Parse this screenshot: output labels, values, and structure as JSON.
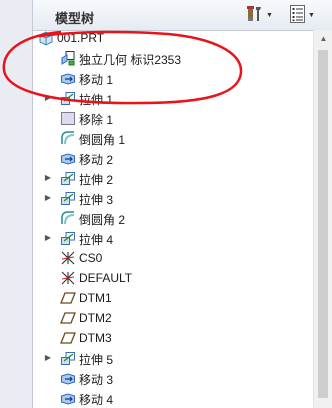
{
  "header": {
    "title": "模型树"
  },
  "icons": {
    "settings": "tools-icon",
    "show": "list-view-icon"
  },
  "tree": {
    "items": [
      {
        "label": "001.PRT",
        "icon": "part-icon",
        "expandable": false
      },
      {
        "label": "独立几何 标识2353",
        "icon": "independent-geometry-icon",
        "expandable": false
      },
      {
        "label": "移动 1",
        "icon": "move-feature-icon",
        "expandable": false
      },
      {
        "label": "拉伸 1",
        "icon": "extrude-icon",
        "expandable": true
      },
      {
        "label": "移除 1",
        "icon": "remove-icon",
        "expandable": false
      },
      {
        "label": "倒圆角 1",
        "icon": "round-icon",
        "expandable": false
      },
      {
        "label": "移动 2",
        "icon": "move-feature-icon",
        "expandable": false
      },
      {
        "label": "拉伸 2",
        "icon": "extrude-icon",
        "expandable": true
      },
      {
        "label": "拉伸 3",
        "icon": "extrude-icon",
        "expandable": true
      },
      {
        "label": "倒圆角 2",
        "icon": "round-icon",
        "expandable": false
      },
      {
        "label": "拉伸 4",
        "icon": "extrude-icon",
        "expandable": true
      },
      {
        "label": "CS0",
        "icon": "coordinate-system-icon",
        "expandable": false
      },
      {
        "label": "DEFAULT",
        "icon": "coordinate-system-icon",
        "expandable": false
      },
      {
        "label": "DTM1",
        "icon": "datum-plane-icon",
        "expandable": false
      },
      {
        "label": "DTM2",
        "icon": "datum-plane-icon",
        "expandable": false
      },
      {
        "label": "DTM3",
        "icon": "datum-plane-icon",
        "expandable": false
      },
      {
        "label": "拉伸 5",
        "icon": "extrude-icon",
        "expandable": true
      },
      {
        "label": "移动 3",
        "icon": "move-feature-icon",
        "expandable": false
      },
      {
        "label": "移动 4",
        "icon": "move-feature-icon",
        "expandable": false
      }
    ]
  },
  "colors": {
    "annotation": "#e8131b",
    "accent_blue": "#2a66c8"
  }
}
